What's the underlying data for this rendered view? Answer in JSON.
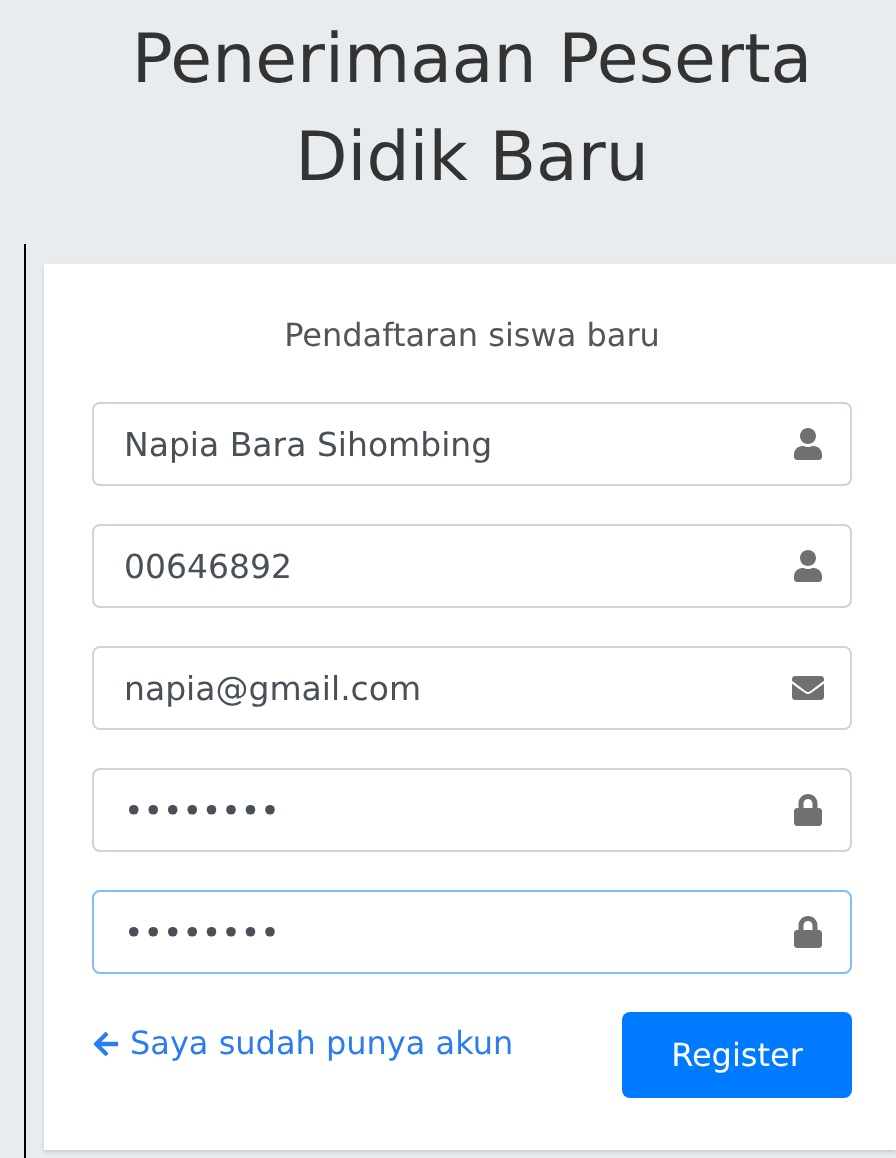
{
  "title": "Penerimaan Peserta Didik Baru",
  "form": {
    "heading": "Pendaftaran siswa baru",
    "fields": [
      {
        "value": "Napia Bara Sihombing",
        "kind": "text",
        "focused": false
      },
      {
        "value": "00646892",
        "kind": "text",
        "focused": false
      },
      {
        "value": "napia@gmail.com",
        "kind": "email",
        "focused": false
      },
      {
        "value": "••••••••",
        "kind": "password",
        "focused": false
      },
      {
        "value": "••••••••",
        "kind": "password",
        "focused": true
      }
    ],
    "login_link": "Saya sudah punya akun",
    "submit": "Register"
  }
}
